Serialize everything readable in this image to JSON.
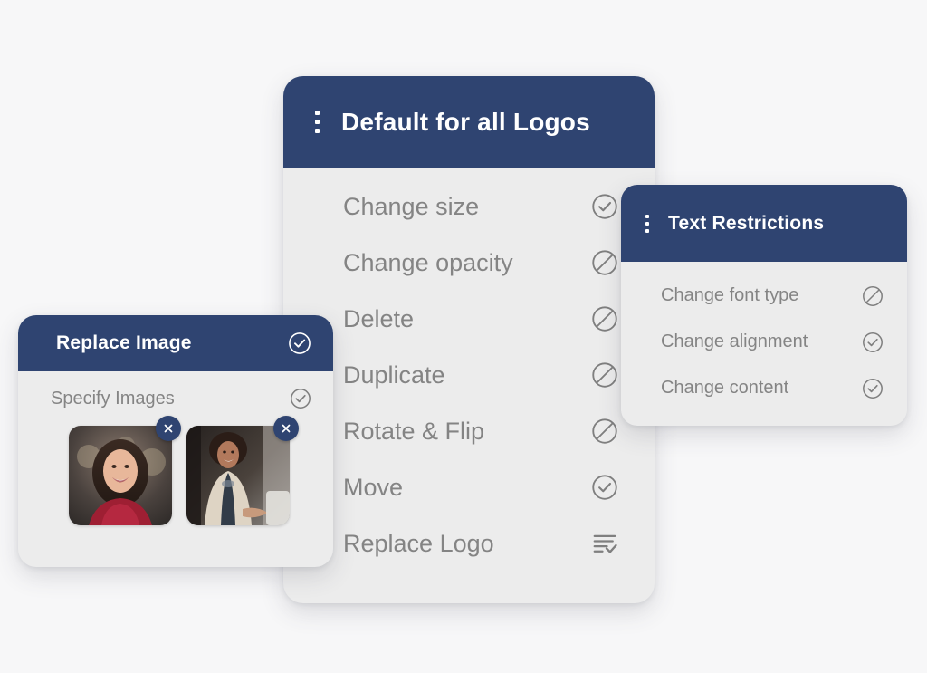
{
  "theme": {
    "navy": "#2f4471",
    "panel_bg": "#ececec",
    "page_bg": "#f7f7f8",
    "label_gray": "#848484",
    "icon_gray": "#7f7f7f"
  },
  "panels": {
    "main": {
      "title": "Default for all Logos",
      "kebab_icon": "kebab-menu-icon",
      "items": [
        {
          "label": "Change size",
          "status": "allowed",
          "icon": "check-circle-icon"
        },
        {
          "label": "Change opacity",
          "status": "blocked",
          "icon": "prohibited-circle-icon"
        },
        {
          "label": "Delete",
          "status": "blocked",
          "icon": "prohibited-circle-icon"
        },
        {
          "label": "Duplicate",
          "status": "blocked",
          "icon": "prohibited-circle-icon"
        },
        {
          "label": "Rotate & Flip",
          "status": "blocked",
          "icon": "prohibited-circle-icon"
        },
        {
          "label": "Move",
          "status": "allowed",
          "icon": "check-circle-icon"
        },
        {
          "label": "Replace Logo",
          "status": "list",
          "icon": "list-check-icon"
        }
      ]
    },
    "text_restrictions": {
      "title": "Text Restrictions",
      "kebab_icon": "kebab-menu-icon",
      "items": [
        {
          "label": "Change font type",
          "status": "blocked",
          "icon": "prohibited-circle-icon"
        },
        {
          "label": "Change alignment",
          "status": "allowed",
          "icon": "check-circle-icon"
        },
        {
          "label": "Change content",
          "status": "allowed",
          "icon": "check-circle-icon"
        }
      ]
    },
    "replace_image": {
      "title": "Replace Image",
      "header_icon": "check-circle-icon",
      "items": [
        {
          "label": "Specify Images",
          "status": "allowed",
          "icon": "check-circle-icon"
        }
      ],
      "thumbnails": [
        {
          "alt": "Smiling woman in red top",
          "remove_icon": "close-icon"
        },
        {
          "alt": "Woman in cream blazer shaking hands",
          "remove_icon": "close-icon"
        }
      ]
    }
  }
}
